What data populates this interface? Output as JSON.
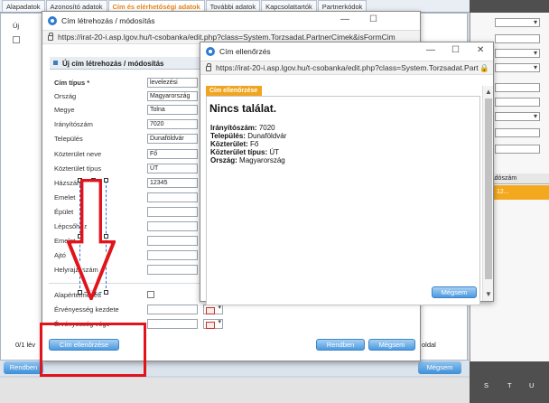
{
  "background": {
    "tabs": [
      "Alapadatok",
      "Azonosító adatok",
      "Cím és elérhetőségi adatok",
      "További adatok",
      "Kapcsolattartók",
      "Partnerkódok"
    ],
    "active_tab_index": 2,
    "toolbar_label": "Új",
    "status_left": "0/1 lév",
    "status_right": "oldal",
    "rendben_label": "Rendben",
    "megsem_label": "Mégsem",
    "right_header": "Adószám",
    "right_highlight": "12...",
    "right_letters": [
      "S",
      "T",
      "U"
    ]
  },
  "popup_form": {
    "window_title": "Cím létrehozás / módosítás",
    "url": "https://irat-20-i.asp.lgov.hu/t-csobanka/edit.php?class=System.Torzsadat.PartnerCimek&isFormCim",
    "header": "Új cím létrehozás / módosítás",
    "fields": [
      {
        "label": "Cím típus *",
        "value": "levelezési",
        "required": true
      },
      {
        "label": "Ország",
        "value": "Magyarország"
      },
      {
        "label": "Megye",
        "value": "Tolna"
      },
      {
        "label": "Irányítószám",
        "value": "7020"
      },
      {
        "label": "Település",
        "value": "Dunaföldvár"
      },
      {
        "label": "Közterület neve",
        "value": "Fő"
      },
      {
        "label": "Közterület típus",
        "value": "ÚT"
      },
      {
        "label": "Házszám",
        "value": "12345"
      },
      {
        "label": "Emelet",
        "value": ""
      },
      {
        "label": "Épület",
        "value": ""
      },
      {
        "label": "Lépcsőház",
        "value": ""
      },
      {
        "label": "Emelet",
        "value": ""
      },
      {
        "label": "Ajtó",
        "value": ""
      },
      {
        "label": "Helyrajzi szám",
        "value": ""
      }
    ],
    "alapertelmezett_label": "Alapértelmezett",
    "ervenyesseg_kezdete_label": "Érvényesség kezdete",
    "ervenyesseg_vege_label": "Érvényesség vége",
    "cim_ellenorzese_label": "Cím ellenőrzése",
    "rendben_label": "Rendben",
    "megsem_label": "Mégsem"
  },
  "popup_check": {
    "window_title": "Cím ellenőrzés",
    "url": "https://irat-20-i.asp.lgov.hu/t-csobanka/edit.php?class=System.Torzsadat.Part",
    "tab_label": "Cím ellenőrzése",
    "result_title": "Nincs találat.",
    "lines": [
      {
        "label": "Irányítószám:",
        "value": "7020"
      },
      {
        "label": "Település:",
        "value": "Dunaföldvár"
      },
      {
        "label": "Közterület:",
        "value": "Fő"
      },
      {
        "label": "Közterület típus:",
        "value": "ÚT"
      },
      {
        "label": "Ország:",
        "value": "Magyarország"
      }
    ],
    "megsem_label": "Mégsem"
  },
  "colors": {
    "accent_orange": "#f0a420",
    "button_blue": "#4c9ae0",
    "annotation_red": "#e1141b"
  }
}
